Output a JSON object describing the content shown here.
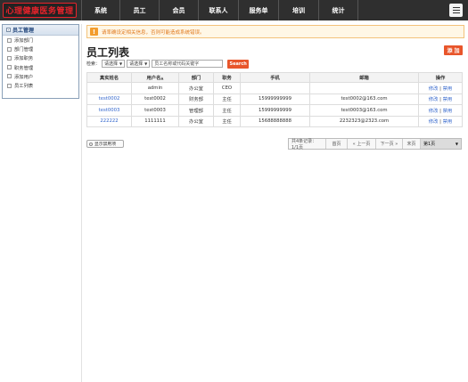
{
  "logo": {
    "text": "心理健康医务管理"
  },
  "nav": [
    {
      "label": "系统"
    },
    {
      "label": "员工"
    },
    {
      "label": "会员"
    },
    {
      "label": "联系人"
    },
    {
      "label": "服务单"
    },
    {
      "label": "培训"
    },
    {
      "label": "统计"
    }
  ],
  "sidebar": {
    "title": "员工管理",
    "items": [
      {
        "label": "添加部门"
      },
      {
        "label": "部门管理"
      },
      {
        "label": "添加职务"
      },
      {
        "label": "职务管理"
      },
      {
        "label": "添加用户"
      },
      {
        "label": "员工列表"
      }
    ]
  },
  "warning": {
    "text": "请率确设定相关信息，否则可能造成系统错误。"
  },
  "page": {
    "title": "员工列表",
    "add_label": "添 加"
  },
  "search": {
    "label": "检索：",
    "select1": "请选择",
    "select2": "请选择",
    "keyword_placeholder": "员工名称或代码关键字",
    "button": "Search"
  },
  "table": {
    "headers": [
      "真实姓名",
      "用户名",
      "部门",
      "职务",
      "手机",
      "邮箱",
      "操作"
    ],
    "rows": [
      {
        "name": "",
        "username": "admin",
        "dept": "办公室",
        "position": "CEO",
        "phone": "",
        "email": "",
        "edit": "修改",
        "sep": "|",
        "disable": "禁用"
      },
      {
        "name": "test0002",
        "username": "test0002",
        "dept": "财务部",
        "position": "主任",
        "phone": "15999999999",
        "email": "test0002@163.com",
        "edit": "修改",
        "sep": "|",
        "disable": "禁用"
      },
      {
        "name": "test0003",
        "username": "test0003",
        "dept": "管理部",
        "position": "主任",
        "phone": "15999999999",
        "email": "test0003@163.com",
        "edit": "修改",
        "sep": "|",
        "disable": "禁用"
      },
      {
        "name": "222222",
        "username": "1111111",
        "dept": "办公室",
        "position": "主任",
        "phone": "15688888888",
        "email": "2232323@2323.com",
        "edit": "修改",
        "sep": "|",
        "disable": "禁用"
      }
    ]
  },
  "footer": {
    "show_disabled": "显示禁用项",
    "total": "共4条记录：1/1页",
    "first": "首页",
    "prev": "« 上一页",
    "next": "下一页 »",
    "last": "末页",
    "page_select": "第1页"
  }
}
